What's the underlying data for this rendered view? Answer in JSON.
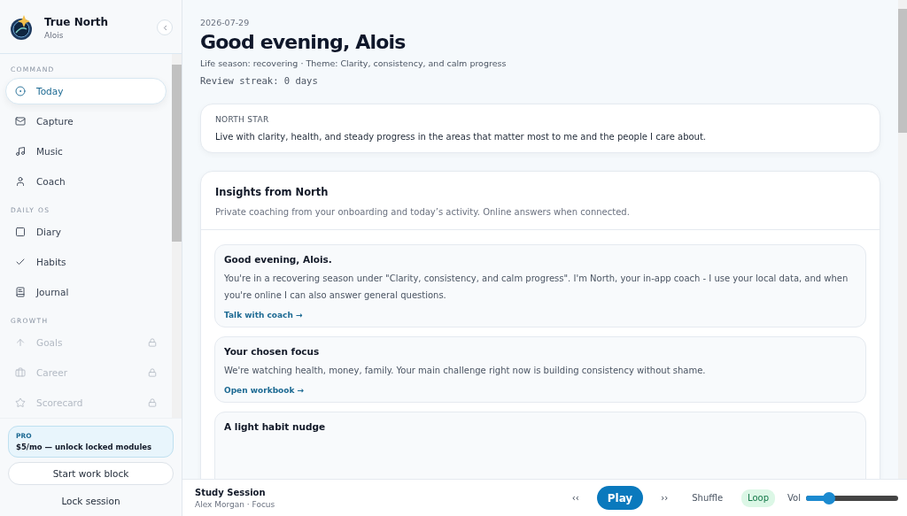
{
  "app": {
    "name": "True North",
    "user": "Alois"
  },
  "sidebar": {
    "sections": [
      {
        "label": "COMMAND",
        "items": [
          {
            "label": "Today",
            "selected": true,
            "locked": false
          },
          {
            "label": "Capture",
            "selected": false,
            "locked": false
          },
          {
            "label": "Music",
            "selected": false,
            "locked": false
          },
          {
            "label": "Coach",
            "selected": false,
            "locked": false
          }
        ]
      },
      {
        "label": "DAILY OS",
        "items": [
          {
            "label": "Diary",
            "selected": false,
            "locked": false
          },
          {
            "label": "Habits",
            "selected": false,
            "locked": false
          },
          {
            "label": "Journal",
            "selected": false,
            "locked": false
          }
        ]
      },
      {
        "label": "GROWTH",
        "items": [
          {
            "label": "Goals",
            "selected": false,
            "locked": true
          },
          {
            "label": "Career",
            "selected": false,
            "locked": true
          },
          {
            "label": "Scorecard",
            "selected": false,
            "locked": true
          }
        ]
      }
    ]
  },
  "pro": {
    "badge": "PRO",
    "text": "$5/mo — unlock locked modules"
  },
  "buttons": {
    "work_block": "Start work block",
    "lock": "Lock session"
  },
  "header": {
    "date": "2026-07-29",
    "title": "Good evening, Alois",
    "subtitle": "Life season: recovering · Theme: Clarity, consistency, and calm progress",
    "streak": "Review streak: 0 days"
  },
  "north_star": {
    "label": "NORTH STAR",
    "text": "Live with clarity, health, and steady progress in the areas that matter most to me and the people I care about."
  },
  "insights": {
    "title": "Insights from North",
    "subtitle": "Private coaching from your onboarding and today’s activity. Online answers when connected.",
    "cards": [
      {
        "title": "Good evening, Alois.",
        "text": "You're in a recovering season under \"Clarity, consistency, and calm progress\". I'm North, your in-app coach - I use your local data, and when you're online I can also answer general questions.",
        "link": "Talk with coach →"
      },
      {
        "title": "Your chosen focus",
        "text": "We're watching health, money, family. Your main challenge right now is building consistency without shame.",
        "link": "Open workbook →"
      },
      {
        "title": "A light habit nudge"
      }
    ]
  },
  "player": {
    "track": "Study Session",
    "artist": "Alex Morgan · Focus",
    "prev": "‹‹",
    "play": "Play",
    "next": "››",
    "shuffle": {
      "label": "Shuffle",
      "on": false
    },
    "loop": {
      "label": "Loop",
      "on": true
    },
    "volume_label": "Vol",
    "level": 0.25
  }
}
